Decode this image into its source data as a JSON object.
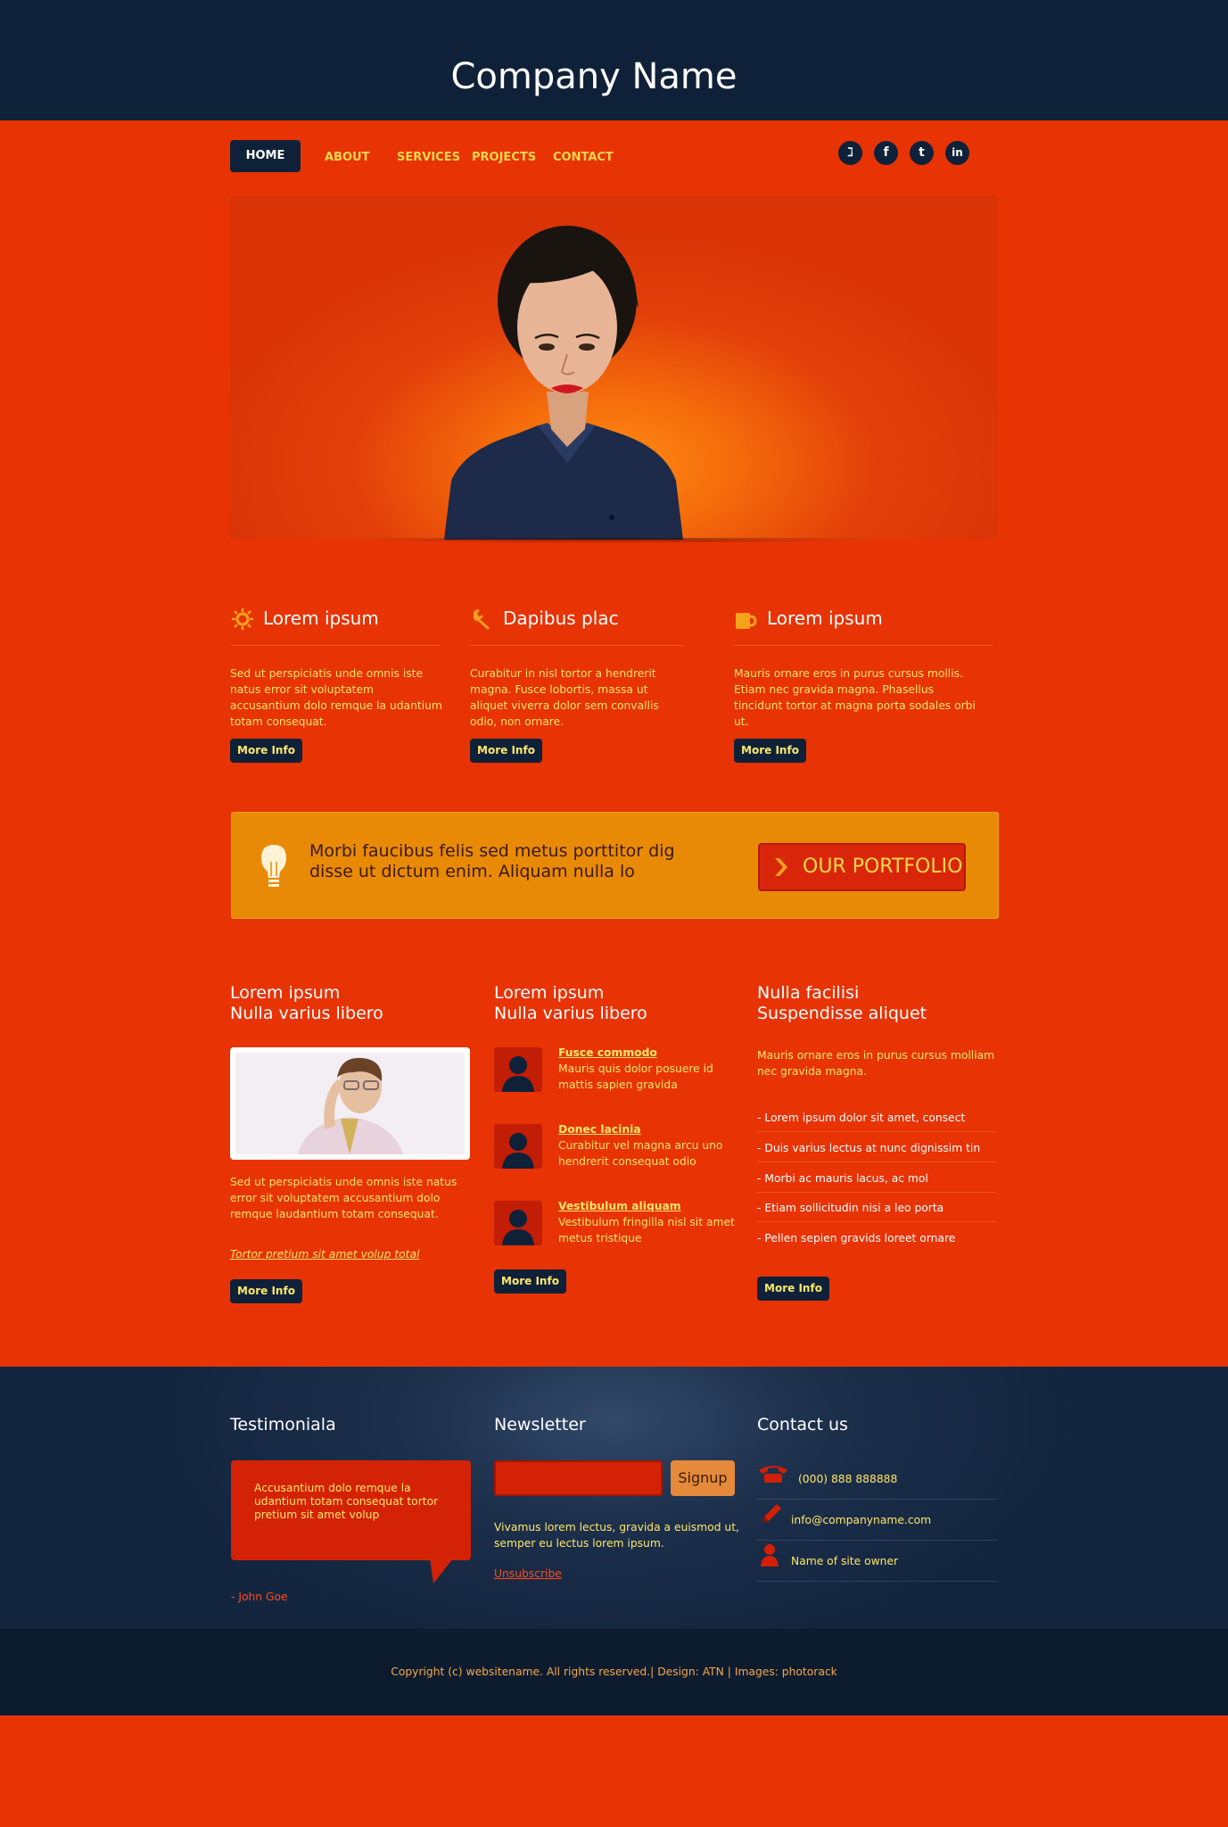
{
  "header": {
    "title": "Company Name"
  },
  "nav": {
    "items": [
      "HOME",
      "ABOUT",
      "SERVICES",
      "PROJECTS",
      "CONTACT"
    ],
    "social": [
      "delicious-icon",
      "facebook-icon",
      "twitter-icon",
      "linkedin-icon"
    ],
    "social_glyphs": [
      "ℷ",
      "f",
      "t",
      "in"
    ]
  },
  "features": [
    {
      "icon": "sun-icon",
      "title": "Lorem ipsum",
      "text": "Sed ut perspiciatis unde omnis iste natus error sit voluptatem accusantium dolo remque la udantium totam consequat.",
      "button": "More Info"
    },
    {
      "icon": "wrench-icon",
      "title": "Dapibus plac",
      "text": "Curabitur in nisl tortor a hendrerit magna. Fusce lobortis, massa ut aliquet viverra dolor sem convallis odio, non ornare.",
      "button": "More Info"
    },
    {
      "icon": "mug-icon",
      "title": "Lorem ipsum",
      "text": "Mauris ornare eros in purus cursus mollis. Etiam nec gravida magna. Phasellus tincidunt tortor at magna porta sodales orbi ut.",
      "button": "More Info"
    }
  ],
  "banner": {
    "text": "Morbi faucibus felis sed metus porttitor dig disse ut dictum enim. Aliquam nulla lo",
    "button": "OUR PORTFOLIO"
  },
  "col1": {
    "heading_line1": "Lorem ipsum",
    "heading_line2": "Nulla varius libero",
    "text": "Sed ut perspiciatis unde omnis iste natus error sit voluptatem accusantium dolo remque laudantium totam consequat.",
    "link": "Tortor pretium sit amet volup total",
    "button": "More Info"
  },
  "col2": {
    "heading_line1": "Lorem ipsum",
    "heading_line2": "Nulla varius libero",
    "items": [
      {
        "title": "Fusce commodo",
        "text": "Mauris quis dolor posuere id mattis sapien gravida"
      },
      {
        "title": "Donec lacinia",
        "text": "Curabitur vel magna arcu uno hendrerit consequat odio"
      },
      {
        "title": "Vestibulum aliquam",
        "text": "Vestibulum fringilla nisl sit amet metus tristique"
      }
    ],
    "button": "More Info"
  },
  "col3": {
    "heading_line1": "Nulla facilisi",
    "heading_line2": "Suspendisse aliquet",
    "text": "Mauris ornare eros in purus cursus molliam nec gravida magna.",
    "bullets": [
      "- Lorem ipsum dolor sit amet, consect",
      "- Duis varius lectus at nunc dignissim tin",
      "- Morbi ac mauris lacus, ac mol",
      "- Etiam sollicitudin nisi a leo porta",
      "- Pellen sepien gravids loreet ornare"
    ],
    "button": "More Info"
  },
  "footer": {
    "testimonial": {
      "heading": "Testimoniala",
      "quote": "Accusantium dolo remque la udantium totam consequat tortor pretium sit amet volup",
      "author": "- John Goe"
    },
    "newsletter": {
      "heading": "Newsletter",
      "input_value": "",
      "button": "Signup",
      "text": "Vivamus lorem lectus, gravida a euismod ut, semper eu lectus lorem ipsum.",
      "unsubscribe": "Unsubscribe"
    },
    "contact": {
      "heading": "Contact us",
      "phone": "(000) 888 888888",
      "email": "info@companyname.com",
      "owner": "Name of site owner"
    },
    "copyright": "Copyright (c) websitename. All rights reserved.| Design: ATN | Images: photorack"
  },
  "colors": {
    "orange_bg": "#e83304",
    "navy": "#0f2138",
    "yellow_text": "#ffe76a",
    "banner": "#e98a07"
  }
}
